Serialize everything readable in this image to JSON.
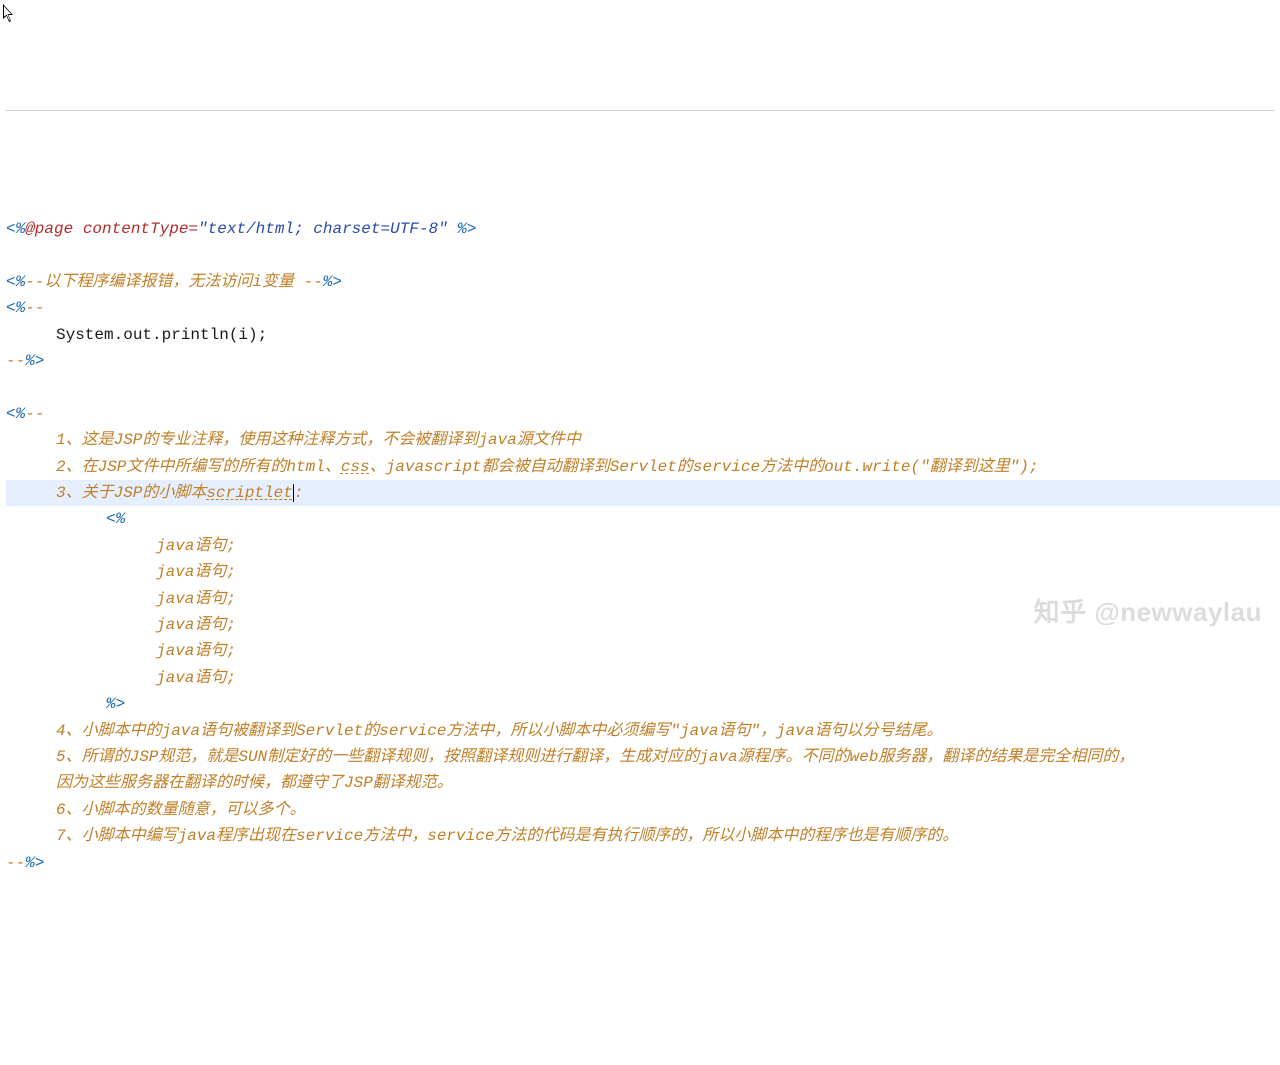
{
  "watermark": "知乎 @newwaylau",
  "lines": [
    {
      "cls": "row",
      "segs": [
        {
          "c": "tag",
          "t": "<%"
        },
        {
          "c": "dir",
          "t": "@page"
        },
        {
          "c": "dir",
          "t": " contentType"
        },
        {
          "c": "dir",
          "t": "="
        },
        {
          "c": "str",
          "t": "\"text/html; charset=UTF-8\""
        },
        {
          "c": "dir",
          "t": " "
        },
        {
          "c": "tag",
          "t": "%>"
        }
      ]
    },
    {
      "cls": "row",
      "segs": [
        {
          "c": "txt",
          "t": " "
        }
      ]
    },
    {
      "cls": "row",
      "segs": [
        {
          "c": "tag",
          "t": "<%"
        },
        {
          "c": "txt",
          "t": "--以下程序编译报错，无法访问i变量 --"
        },
        {
          "c": "tag",
          "t": "%>"
        }
      ]
    },
    {
      "cls": "row",
      "segs": [
        {
          "c": "tag",
          "t": "<%"
        },
        {
          "c": "txt",
          "t": "--"
        }
      ]
    },
    {
      "cls": "row indent1",
      "segs": [
        {
          "c": "code",
          "t": "System.out.println(i);"
        }
      ]
    },
    {
      "cls": "row",
      "segs": [
        {
          "c": "txt",
          "t": "--"
        },
        {
          "c": "tag",
          "t": "%>"
        }
      ]
    },
    {
      "cls": "row",
      "segs": [
        {
          "c": "txt",
          "t": " "
        }
      ]
    },
    {
      "cls": "row",
      "segs": [
        {
          "c": "tag",
          "t": "<%"
        },
        {
          "c": "txt",
          "t": "--"
        }
      ]
    },
    {
      "cls": "row indent1",
      "segs": [
        {
          "c": "txt",
          "t": "1、这是JSP的专业注释，使用这种注释方式，不会被翻译到java源文件中"
        }
      ]
    },
    {
      "cls": "row indent1",
      "segs": [
        {
          "c": "txt",
          "t": "2、在JSP文件中所编写的所有的html、"
        },
        {
          "c": "txt spell",
          "t": "css"
        },
        {
          "c": "txt",
          "t": "、javascript都会被自动翻译到Servlet的service方法中的out.write(\"翻译到这里\");"
        }
      ]
    },
    {
      "cls": "row indent1 hl",
      "segs": [
        {
          "c": "txt",
          "t": "3、关于JSP的小脚本"
        },
        {
          "c": "txt spell cursor",
          "t": "scriptlet"
        },
        {
          "c": "txt",
          "t": ":"
        }
      ]
    },
    {
      "cls": "row indent2",
      "segs": [
        {
          "c": "tag",
          "t": "<%"
        }
      ]
    },
    {
      "cls": "row indent3",
      "segs": [
        {
          "c": "txt",
          "t": "java语句;"
        }
      ]
    },
    {
      "cls": "row indent3",
      "segs": [
        {
          "c": "txt",
          "t": "java语句;"
        }
      ]
    },
    {
      "cls": "row indent3",
      "segs": [
        {
          "c": "txt",
          "t": "java语句;"
        }
      ]
    },
    {
      "cls": "row indent3",
      "segs": [
        {
          "c": "txt",
          "t": "java语句;"
        }
      ]
    },
    {
      "cls": "row indent3",
      "segs": [
        {
          "c": "txt",
          "t": "java语句;"
        }
      ]
    },
    {
      "cls": "row indent3",
      "segs": [
        {
          "c": "txt",
          "t": "java语句;"
        }
      ]
    },
    {
      "cls": "row indent2",
      "segs": [
        {
          "c": "tag",
          "t": "%>"
        }
      ]
    },
    {
      "cls": "row indent1",
      "segs": [
        {
          "c": "txt",
          "t": "4、小脚本中的java语句被翻译到Servlet的service方法中，所以小脚本中必须编写\"java语句\"，java语句以分号结尾。"
        }
      ]
    },
    {
      "cls": "row indent1",
      "segs": [
        {
          "c": "txt",
          "t": "5、所谓的JSP规范，就是SUN制定好的一些翻译规则，按照翻译规则进行翻译，生成对应的java源程序。不同的web服务器，翻译的结果是完全相同的，"
        }
      ]
    },
    {
      "cls": "row indent1",
      "segs": [
        {
          "c": "txt",
          "t": "因为这些服务器在翻译的时候，都遵守了JSP翻译规范。"
        }
      ]
    },
    {
      "cls": "row indent1",
      "segs": [
        {
          "c": "txt",
          "t": "6、小脚本的数量随意，可以多个。"
        }
      ]
    },
    {
      "cls": "row indent1",
      "segs": [
        {
          "c": "txt",
          "t": "7、小脚本中编写java程序出现在service方法中，service方法的代码是有执行顺序的，所以小脚本中的程序也是有顺序的。"
        }
      ]
    },
    {
      "cls": "row",
      "segs": [
        {
          "c": "txt",
          "t": "--"
        },
        {
          "c": "tag",
          "t": "%>"
        }
      ]
    }
  ]
}
